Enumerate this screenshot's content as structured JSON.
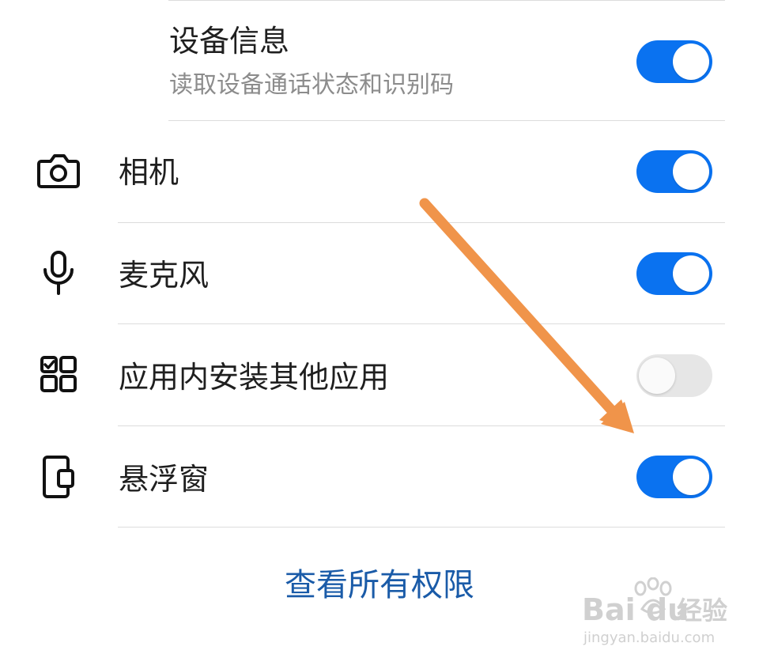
{
  "permissions": [
    {
      "title": "设备信息",
      "subtitle": "读取设备通话状态和识别码",
      "icon": "none",
      "enabled": true
    },
    {
      "title": "相机",
      "icon": "camera-icon",
      "enabled": true
    },
    {
      "title": "麦克风",
      "icon": "microphone-icon",
      "enabled": true
    },
    {
      "title": "应用内安装其他应用",
      "icon": "apps-install-icon",
      "enabled": false
    },
    {
      "title": "悬浮窗",
      "icon": "floating-window-icon",
      "enabled": true
    }
  ],
  "view_all_link": "查看所有权限",
  "watermark": {
    "brand": "Bai  du",
    "suffix": "经验",
    "url": "jingyan.baidu.com"
  },
  "colors": {
    "toggle_on": "#0a72f0",
    "toggle_off": "#e6e6e6",
    "link": "#1a5ba8",
    "annotation_arrow": "#f0944a"
  }
}
